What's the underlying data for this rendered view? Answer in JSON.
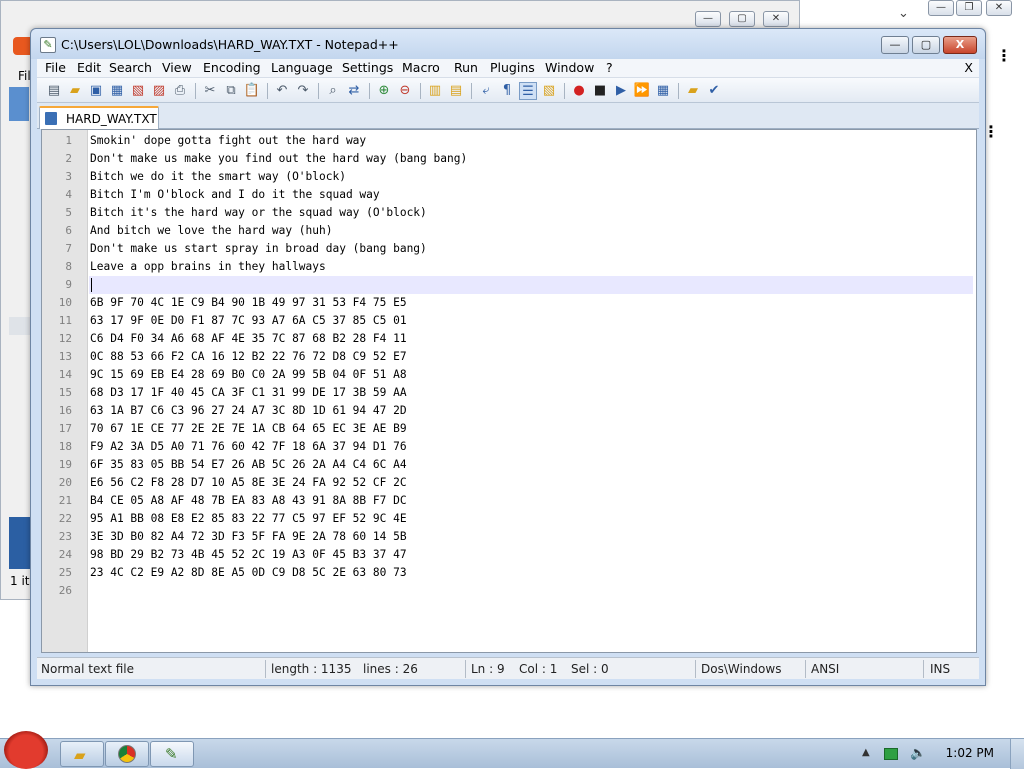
{
  "window": {
    "title": "C:\\Users\\LOL\\Downloads\\HARD_WAY.TXT - Notepad++",
    "buttons": {
      "minimize": "—",
      "maximize": "▢",
      "close": "X"
    }
  },
  "menu": [
    "File",
    "Edit",
    "Search",
    "View",
    "Encoding",
    "Language",
    "Settings",
    "Macro",
    "Run",
    "Plugins",
    "Window",
    "?"
  ],
  "menu_close": "X",
  "toolbar": [
    "new-file-icon",
    "open-file-icon",
    "save-icon",
    "save-all-icon",
    "close-icon",
    "close-all-icon",
    "print-icon",
    "cut-icon",
    "copy-icon",
    "paste-icon",
    "undo-icon",
    "redo-icon",
    "find-icon",
    "replace-icon",
    "zoom-in-icon",
    "zoom-out-icon",
    "sync-vertical-icon",
    "sync-horizontal-icon",
    "word-wrap-icon",
    "show-all-chars-icon",
    "indent-guide-icon",
    "user-language-icon",
    "record-macro-icon",
    "stop-record-icon",
    "play-macro-icon",
    "run-macro-multiple-icon",
    "save-macro-icon",
    "open-folder-icon",
    "spell-check-icon"
  ],
  "tab": {
    "label": "HARD_WAY.TXT"
  },
  "editor": {
    "lines": [
      "Smokin' dope gotta fight out the hard way",
      "Don't make us make you find out the hard way (bang bang)",
      "Bitch we do it the smart way (O'block)",
      "Bitch I'm O'block and I do it the squad way",
      "Bitch it's the hard way or the squad way (O'block)",
      "And bitch we love the hard way (huh)",
      "Don't make us start spray in broad day (bang bang)",
      "Leave a opp brains in they hallways",
      "",
      "6B 9F 70 4C 1E C9 B4 90 1B 49 97 31 53 F4 75 E5",
      "63 17 9F 0E D0 F1 87 7C 93 A7 6A C5 37 85 C5 01",
      "C6 D4 F0 34 A6 68 AF 4E 35 7C 87 68 B2 28 F4 11",
      "0C 88 53 66 F2 CA 16 12 B2 22 76 72 D8 C9 52 E7",
      "9C 15 69 EB E4 28 69 B0 C0 2A 99 5B 04 0F 51 A8",
      "68 D3 17 1F 40 45 CA 3F C1 31 99 DE 17 3B 59 AA",
      "63 1A B7 C6 C3 96 27 24 A7 3C 8D 1D 61 94 47 2D",
      "70 67 1E CE 77 2E 2E 7E 1A CB 64 65 EC 3E AE B9",
      "F9 A2 3A D5 A0 71 76 60 42 7F 18 6A 37 94 D1 76",
      "6F 35 83 05 BB 54 E7 26 AB 5C 26 2A A4 C4 6C A4",
      "E6 56 C2 F8 28 D7 10 A5 8E 3E 24 FA 92 52 CF 2C",
      "B4 CE 05 A8 AF 48 7B EA 83 A8 43 91 8A 8B F7 DC",
      "95 A1 BB 08 E8 E2 85 83 22 77 C5 97 EF 52 9C 4E",
      "3E 3D B0 82 A4 72 3D F3 5F FA 9E 2A 78 60 14 5B",
      "98 BD 29 B2 73 4B 45 52 2C 19 A3 0F 45 B3 37 47",
      "23 4C C2 E9 A2 8D 8E A5 0D C9 D8 5C 2E 63 80 73",
      ""
    ],
    "current_line": 9
  },
  "status": {
    "type": "Normal text file",
    "length": "length : 1135",
    "lines": "lines : 26",
    "ln": "Ln : 9",
    "col": "Col : 1",
    "sel": "Sel : 0",
    "eol": "Dos\\Windows",
    "encoding": "ANSI",
    "mode": "INS"
  },
  "background": {
    "menu_fragment": "Fil",
    "status_fragment": "1 ite"
  },
  "taskbar": {
    "clock": "1:02 PM"
  }
}
